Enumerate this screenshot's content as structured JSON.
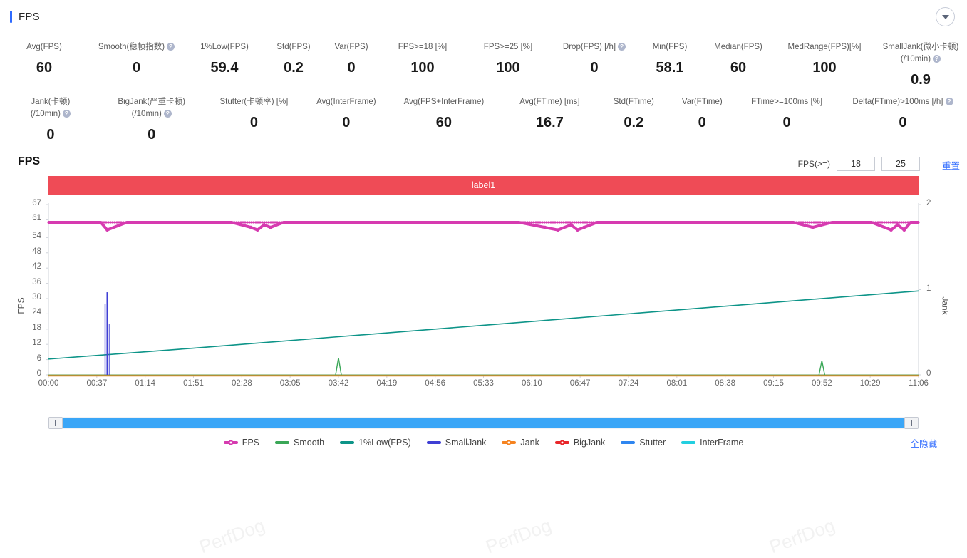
{
  "header": {
    "title": "FPS",
    "collapse_icon": "chevron-down-icon"
  },
  "metrics_row1": [
    {
      "label": "Avg(FPS)",
      "value": "60",
      "help": false
    },
    {
      "label": "Smooth(稳帧指数)",
      "value": "0",
      "help": true
    },
    {
      "label": "1%Low(FPS)",
      "value": "59.4",
      "help": false
    },
    {
      "label": "Std(FPS)",
      "value": "0.2",
      "help": false
    },
    {
      "label": "Var(FPS)",
      "value": "0",
      "help": false
    },
    {
      "label": "FPS>=18 [%]",
      "value": "100",
      "help": false
    },
    {
      "label": "FPS>=25 [%]",
      "value": "100",
      "help": false
    },
    {
      "label": "Drop(FPS) [/h]",
      "value": "0",
      "help": true
    },
    {
      "label": "Min(FPS)",
      "value": "58.1",
      "help": false
    },
    {
      "label": "Median(FPS)",
      "value": "60",
      "help": false
    },
    {
      "label": "MedRange(FPS)[%]",
      "value": "100",
      "help": false
    },
    {
      "label": "SmallJank(微小卡顿)\n(/10min)",
      "value": "0.9",
      "help": true
    }
  ],
  "metrics_row2": [
    {
      "label": "Jank(卡顿)\n(/10min)",
      "value": "0",
      "help": true
    },
    {
      "label": "BigJank(严重卡顿)\n(/10min)",
      "value": "0",
      "help": true
    },
    {
      "label": "Stutter(卡顿率) [%]",
      "value": "0",
      "help": false
    },
    {
      "label": "Avg(InterFrame)",
      "value": "0",
      "help": false
    },
    {
      "label": "Avg(FPS+InterFrame)",
      "value": "60",
      "help": false
    },
    {
      "label": "Avg(FTime) [ms]",
      "value": "16.7",
      "help": false
    },
    {
      "label": "Std(FTime)",
      "value": "0.2",
      "help": false
    },
    {
      "label": "Var(FTime)",
      "value": "0",
      "help": false
    },
    {
      "label": "FTime>=100ms [%]",
      "value": "0",
      "help": false
    },
    {
      "label": "Delta(FTime)>100ms [/h]",
      "value": "0",
      "help": true
    }
  ],
  "chart_header": {
    "title": "FPS",
    "fps_filter_label": "FPS(>=)",
    "threshold1": "18",
    "threshold2": "25",
    "reset_label": "重置"
  },
  "label_bar": {
    "text": "label1",
    "color": "#ef4b56"
  },
  "legend": {
    "hide_all_label": "全隐藏",
    "items": [
      {
        "name": "FPS",
        "color": "#d63bb0",
        "marker": true
      },
      {
        "name": "Smooth",
        "color": "#3aa757",
        "marker": false
      },
      {
        "name": "1%Low(FPS)",
        "color": "#0d9488",
        "marker": false
      },
      {
        "name": "SmallJank",
        "color": "#3f3fd4",
        "marker": false
      },
      {
        "name": "Jank",
        "color": "#f58320",
        "marker": true
      },
      {
        "name": "BigJank",
        "color": "#e8262a",
        "marker": true
      },
      {
        "name": "Stutter",
        "color": "#2f86f0",
        "marker": false
      },
      {
        "name": "InterFrame",
        "color": "#22cfe0",
        "marker": false
      }
    ]
  },
  "scrollbar": {
    "left_grip": "drag-handle-icon",
    "right_grip": "drag-handle-icon"
  },
  "watermark": "PerfDog",
  "chart_data": {
    "type": "line",
    "title": "FPS",
    "xlabel": "",
    "ylabel": "FPS",
    "y2label": "Jank",
    "ylim": [
      0,
      67
    ],
    "y2lim": [
      0,
      2
    ],
    "yticks": [
      0,
      6,
      12,
      18,
      24,
      30,
      36,
      42,
      48,
      54,
      61,
      67
    ],
    "y2ticks": [
      0,
      1,
      2
    ],
    "xticks": [
      "00:00",
      "00:37",
      "01:14",
      "01:51",
      "02:28",
      "03:05",
      "03:42",
      "04:19",
      "04:56",
      "05:33",
      "06:10",
      "06:47",
      "07:24",
      "08:01",
      "08:38",
      "09:15",
      "09:52",
      "10:29",
      "11:06"
    ],
    "grid": false,
    "legend_position": "bottom",
    "series": [
      {
        "name": "FPS",
        "color": "#d63bb0",
        "axis": "left",
        "description": "Flat near 60 fps across the whole run with small dips",
        "x": [
          "00:00",
          "00:20",
          "00:40",
          "00:45",
          "01:00",
          "01:30",
          "02:00",
          "02:20",
          "02:35",
          "02:40",
          "02:45",
          "02:50",
          "03:00",
          "03:30",
          "03:40",
          "04:00",
          "04:30",
          "05:00",
          "05:30",
          "06:00",
          "06:20",
          "06:30",
          "06:40",
          "06:45",
          "06:50",
          "07:00",
          "07:30",
          "08:00",
          "08:30",
          "09:00",
          "09:30",
          "09:45",
          "10:00",
          "10:30",
          "10:45",
          "10:50",
          "10:55",
          "11:00",
          "11:06"
        ],
        "y": [
          60,
          60,
          60,
          57,
          60,
          60,
          60,
          60,
          58,
          57,
          59,
          58,
          60,
          60,
          60,
          60,
          60,
          60,
          60,
          60,
          58,
          57,
          59,
          57,
          58,
          60,
          60,
          60,
          60,
          60,
          60,
          58,
          60,
          60,
          57,
          59,
          57,
          60,
          60
        ]
      },
      {
        "name": "1%Low(FPS)",
        "color": "#0d9488",
        "axis": "left",
        "description": "Steady rise from about 6 to 33 across the run",
        "x": [
          "00:00",
          "01:51",
          "03:42",
          "05:33",
          "07:24",
          "09:15",
          "11:06"
        ],
        "y": [
          6.2,
          10.5,
          15.0,
          19.5,
          24.0,
          28.5,
          33.0
        ]
      },
      {
        "name": "SmallJank",
        "color": "#3f3fd4",
        "axis": "right",
        "description": "Single spike near 00:45",
        "x": [
          "00:45"
        ],
        "y": [
          1.0
        ]
      },
      {
        "name": "Jank",
        "color": "#f58320",
        "axis": "right",
        "description": "Flat at zero",
        "x": [
          "00:00",
          "11:06"
        ],
        "y": [
          0,
          0
        ]
      },
      {
        "name": "Smooth",
        "color": "#3aa757",
        "axis": "left",
        "description": "Flat at zero with tiny blips at 03:42 and 09:52",
        "x": [
          "00:00",
          "03:42",
          "09:52",
          "11:06"
        ],
        "y": [
          0,
          1,
          1,
          0
        ]
      }
    ]
  }
}
